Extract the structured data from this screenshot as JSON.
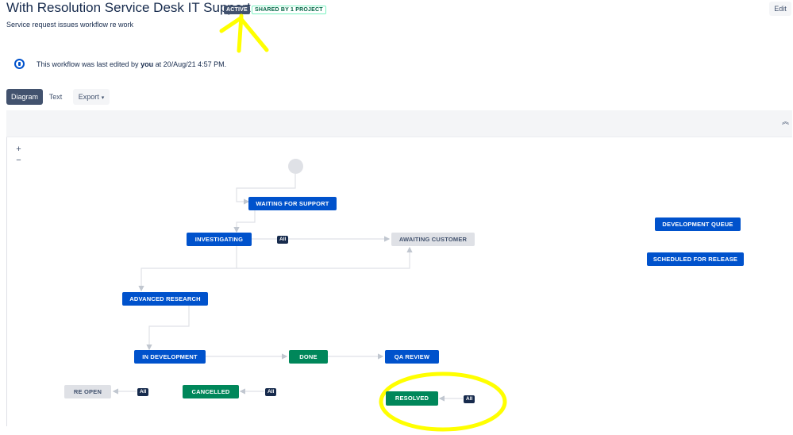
{
  "header": {
    "title": "With Resolution Service Desk IT Support",
    "active_badge": "ACTIVE",
    "shared_badge": "SHARED BY 1 PROJECT",
    "subtitle": "Service request issues workflow re work",
    "edit_label": "Edit"
  },
  "info": {
    "prefix": "This workflow was last edited by ",
    "user": "you",
    "suffix": " at 20/Aug/21 4:57 PM."
  },
  "view_tabs": {
    "diagram": "Diagram",
    "text": "Text",
    "export": "Export"
  },
  "zoom": {
    "plus": "+",
    "minus": "−"
  },
  "statuses": {
    "waiting_for_support": "WAITING FOR SUPPORT",
    "investigating": "INVESTIGATING",
    "awaiting_customer": "AWAITING CUSTOMER",
    "advanced_research": "ADVANCED RESEARCH",
    "in_development": "IN DEVELOPMENT",
    "done": "DONE",
    "qa_review": "QA REVIEW",
    "re_open": "RE OPEN",
    "cancelled": "CANCELLED",
    "resolved": "RESOLVED",
    "development_queue": "DEVELOPMENT QUEUE",
    "scheduled_for_release": "SCHEDULED FOR RELEASE"
  },
  "transitions": {
    "all_label": "All"
  },
  "colors": {
    "status_blue": "#0052cc",
    "status_green": "#00875a",
    "status_grey": "#dfe1e6",
    "highlight_yellow": "#ffff00"
  }
}
